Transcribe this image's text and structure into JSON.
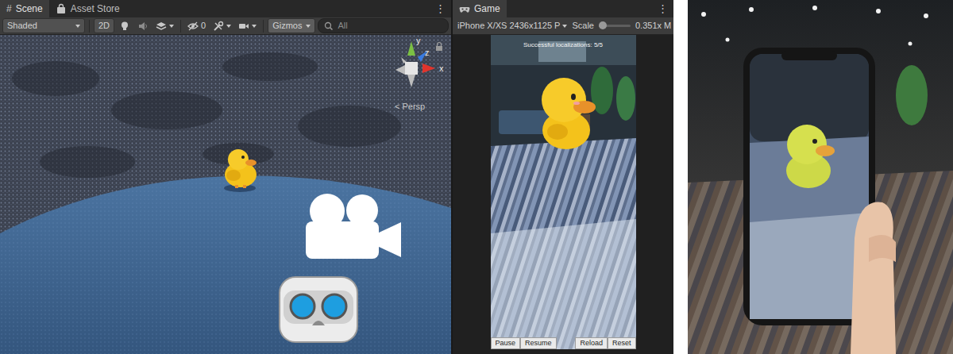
{
  "scene": {
    "tabs": [
      {
        "kind": "scene",
        "icon": "#",
        "label": "Scene",
        "selected": true
      },
      {
        "kind": "store",
        "label": "Asset Store",
        "selected": false
      }
    ],
    "menu": "⋮",
    "toolbar": {
      "shading": "Shaded",
      "mode_2d": "2D",
      "hidden_count": "0",
      "gizmos": "Gizmos",
      "search": {
        "placeholder": "All"
      }
    },
    "orientation": {
      "axes": [
        "y",
        "z",
        "x"
      ],
      "projection": "< Persp"
    }
  },
  "game": {
    "tab": {
      "label": "Game",
      "selected": true
    },
    "menu": "⋮",
    "toolbar": {
      "resolution": "iPhone X/XS 2436x1125 P",
      "scale_label": "Scale",
      "scale": {
        "level": 0.12
      },
      "scale_value": "0.351x",
      "cut_label": "M"
    },
    "app": {
      "status": "Successful localizations: 5/5",
      "buttons": [
        {
          "label": "Pause"
        },
        {
          "label": "Resume"
        },
        {
          "label": "Reload"
        },
        {
          "label": "Reset"
        }
      ]
    }
  }
}
